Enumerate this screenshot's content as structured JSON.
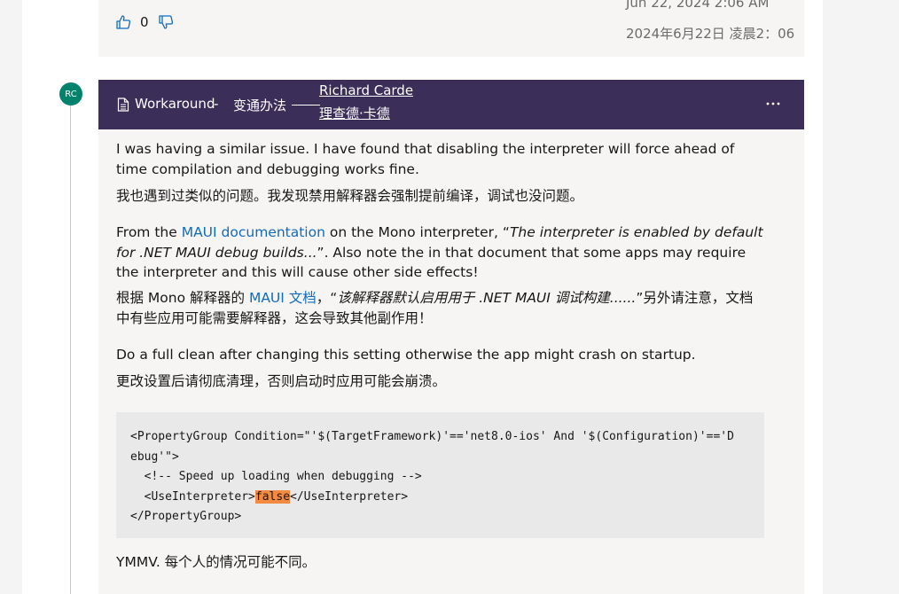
{
  "prev_reply": {
    "vote": {
      "count": "0"
    },
    "date_en": "Jun 22, 2024 2:06 AM",
    "date_zh": "2024年6月22日 凌晨2：06"
  },
  "answer": {
    "avatar_initials": "RC",
    "header": {
      "label": "Workaround",
      "dash": "-",
      "label_zh": "变通办法",
      "author_en": "Richard Carde",
      "author_zh": "理查德·卡德"
    },
    "paragraphs": {
      "p1_en": "I was having a similar issue. I have found that disabling the interpreter will force ahead of time compilation and debugging works fine.",
      "p1_zh": "我也遇到过类似的问题。我发现禁用解释器会强制提前编译，调试也没问题。",
      "p2_en": {
        "pre": "From the ",
        "link": "MAUI documentation",
        "mid": " on the Mono interpreter, “",
        "quote": "The interpreter is enabled by default for .NET MAUI debug builds...",
        "post": "”. Also note the in that document that some apps may require the interpreter and this will cause other side effects!"
      },
      "p2_zh": {
        "pre": "根据 Mono 解释器的 ",
        "link": "MAUI 文档",
        "mid": "，“",
        "quote": "该解释器默认启用用于 .NET MAUI 调试构建......",
        "post": "”另外请注意，文档中有些应用可能需要解释器，这会导致其他副作用！"
      },
      "p3_en": "Do a full clean after changing this setting otherwise the app might crash on startup.",
      "p3_zh": "更改设置后请彻底清理，否则启动时应用可能会崩溃。",
      "p4": "YMMV. 每个人的情况可能不同。"
    },
    "code": {
      "line1": "<PropertyGroup Condition=\"'$(TargetFramework)'=='net8.0-ios' And '$(Configuration)'=='D",
      "line2": "ebug'\">",
      "line3": "  <!-- Speed up loading when debugging -->",
      "line4_pre": "  <UseInterpreter>",
      "line4_hl": "false",
      "line4_post": "</UseInterpreter>",
      "line5": "</PropertyGroup>"
    }
  },
  "colors": {
    "header_bg": "#3b2e58",
    "avatar_bg": "#00826b",
    "link": "#0f6cbd",
    "highlight": "#f38a3f"
  }
}
